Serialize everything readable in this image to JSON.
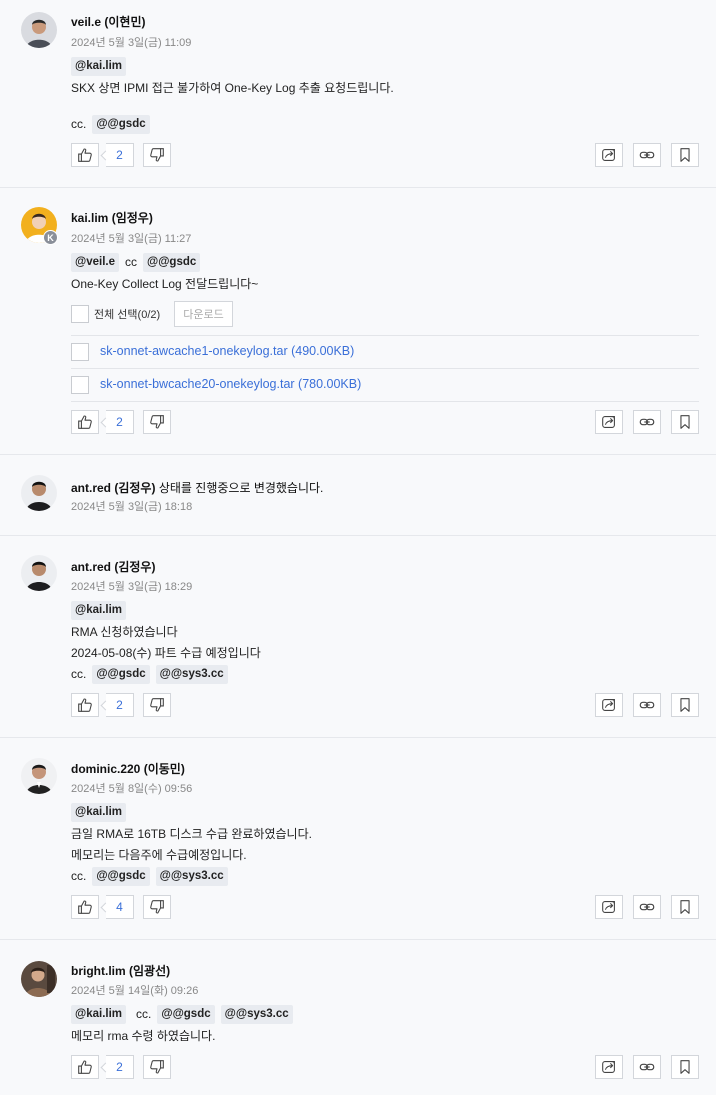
{
  "comments": [
    {
      "user_id": "veil.e",
      "korean_name": "(이현민)",
      "date": "2024년 5월 3일(금) 11:09",
      "mention_line1": [
        "@kai.lim"
      ],
      "body1": "SKX 상면 IPMI 접근 불가하여 One-Key Log 추출 요청드립니다.",
      "cc_label": "cc.",
      "cc_mentions": [
        "@@gsdc"
      ],
      "likes": "2"
    },
    {
      "user_id": "kai.lim",
      "korean_name": "(임정우)",
      "avatar_badge": "K",
      "date": "2024년 5월 3일(금) 11:27",
      "mention_a": "@veil.e",
      "cc_word": "cc",
      "mention_b": "@@gsdc",
      "body1": "One-Key Collect Log 전달드립니다~",
      "select_all": "전체 선택(0/2)",
      "download": "다운로드",
      "files": [
        "sk-onnet-awcache1-onekeylog.tar (490.00KB)",
        "sk-onnet-bwcache20-onekeylog.tar (780.00KB)"
      ],
      "likes": "2"
    },
    {
      "user_id": "ant.red",
      "korean_name": "(김정우)",
      "action": "상태를 진행중으로 변경했습니다.",
      "date": "2024년 5월 3일(금) 18:18"
    },
    {
      "user_id": "ant.red",
      "korean_name": "(김정우)",
      "date": "2024년 5월 3일(금) 18:29",
      "mention": "@kai.lim",
      "body1": "RMA 신청하였습니다",
      "body2": "2024-05-08(수) 파트 수급 예정입니다",
      "cc_label": "cc.",
      "cc_mentions": [
        "@@gsdc",
        "@@sys3.cc"
      ],
      "likes": "2"
    },
    {
      "user_id": "dominic.220",
      "korean_name": "(이동민)",
      "date": "2024년 5월 8일(수) 09:56",
      "mention": "@kai.lim",
      "body1": "금일 RMA로 16TB 디스크 수급 완료하였습니다.",
      "body2": "메모리는 다음주에 수급예정입니다.",
      "cc_label": "cc.",
      "cc_mentions": [
        "@@gsdc",
        "@@sys3.cc"
      ],
      "likes": "4"
    },
    {
      "user_id": "bright.lim",
      "korean_name": "(임광선)",
      "date": "2024년 5월 14일(화) 09:26",
      "mention": "@kai.lim",
      "cc_label": "cc.",
      "cc_mentions": [
        "@@gsdc",
        "@@sys3.cc"
      ],
      "body1": "메모리 rma 수령 하였습니다.",
      "likes": "2"
    }
  ],
  "icons": {
    "like": "thumbs-up-icon",
    "dislike": "thumbs-down-icon",
    "share": "share-icon",
    "link": "link-icon",
    "bookmark": "bookmark-icon"
  },
  "colors": {
    "link": "#3a6fd8",
    "mention_bg": "#e8ebf0",
    "page_bg": "#f8f9fb"
  }
}
